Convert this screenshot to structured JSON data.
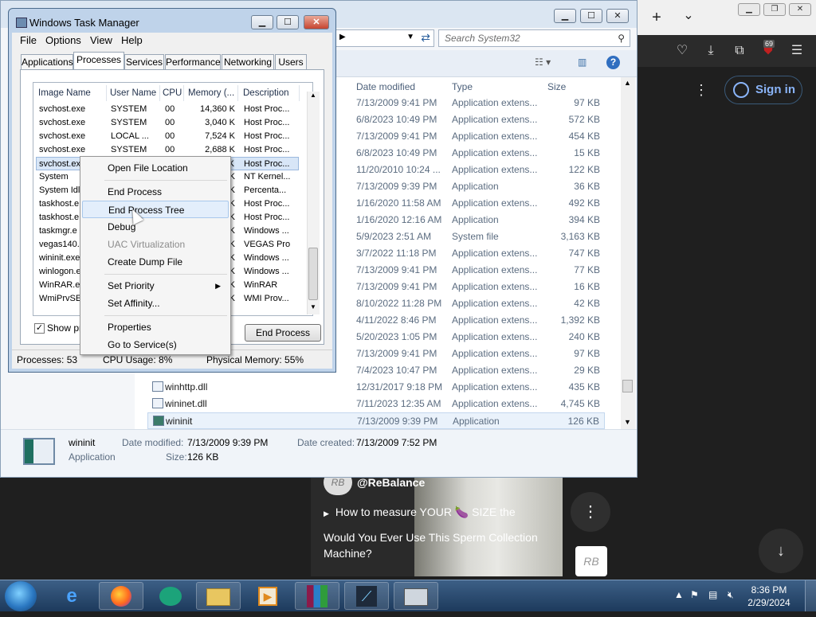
{
  "browser": {
    "new_tab": "+",
    "tab_dropdown": "⌄",
    "extension_badge": "69",
    "sign_in": "Sign in",
    "video": {
      "channel": "@ReBalance",
      "playlist_line": "How to measure YOUR 🍆 SIZE the",
      "title_line1": "Would You Ever Use This Sperm Collection",
      "title_line2": "Machine?",
      "logo_text": "RB"
    }
  },
  "explorer": {
    "search_placeholder": "Search System32",
    "columns": [
      "Date modified",
      "Type",
      "Size"
    ],
    "rows": [
      {
        "date": "7/13/2009 9:41 PM",
        "type": "Application extens...",
        "size": "97 KB"
      },
      {
        "date": "6/8/2023 10:49 PM",
        "type": "Application extens...",
        "size": "572 KB"
      },
      {
        "date": "7/13/2009 9:41 PM",
        "type": "Application extens...",
        "size": "454 KB"
      },
      {
        "date": "6/8/2023 10:49 PM",
        "type": "Application extens...",
        "size": "15 KB"
      },
      {
        "date": "11/20/2010 10:24 ...",
        "type": "Application extens...",
        "size": "122 KB"
      },
      {
        "date": "7/13/2009 9:39 PM",
        "type": "Application",
        "size": "36 KB"
      },
      {
        "date": "1/16/2020 11:58 AM",
        "type": "Application extens...",
        "size": "492 KB"
      },
      {
        "date": "1/16/2020 12:16 AM",
        "type": "Application",
        "size": "394 KB"
      },
      {
        "date": "5/9/2023 2:51 AM",
        "type": "System file",
        "size": "3,163 KB"
      },
      {
        "date": "3/7/2022 11:18 PM",
        "type": "Application extens...",
        "size": "747 KB"
      },
      {
        "date": "7/13/2009 9:41 PM",
        "type": "Application extens...",
        "size": "77 KB"
      },
      {
        "date": "7/13/2009 9:41 PM",
        "type": "Application extens...",
        "size": "16 KB"
      },
      {
        "date": "8/10/2022 11:28 PM",
        "type": "Application extens...",
        "size": "42 KB"
      },
      {
        "date": "4/11/2022 8:46 PM",
        "type": "Application extens...",
        "size": "1,392 KB"
      },
      {
        "date": "5/20/2023 1:05 PM",
        "type": "Application extens...",
        "size": "240 KB"
      },
      {
        "date": "7/13/2009 9:41 PM",
        "type": "Application extens...",
        "size": "97 KB"
      },
      {
        "date": "7/4/2023 10:47 PM",
        "type": "Application extens...",
        "size": "29 KB"
      }
    ],
    "named_rows": [
      {
        "name": "winhttp.dll",
        "date": "12/31/2017 9:18 PM",
        "type": "Application extens...",
        "size": "435 KB"
      },
      {
        "name": "wininet.dll",
        "date": "7/11/2023 12:35 AM",
        "type": "Application extens...",
        "size": "4,745 KB"
      },
      {
        "name": "wininit",
        "date": "7/13/2009 9:39 PM",
        "type": "Application",
        "size": "126 KB"
      }
    ],
    "details": {
      "name": "wininit",
      "kind": "Application",
      "modified_label": "Date modified:",
      "modified": "7/13/2009 9:39 PM",
      "created_label": "Date created:",
      "created": "7/13/2009 7:52 PM",
      "size_label": "Size:",
      "size": "126 KB"
    }
  },
  "taskmgr": {
    "title": "Windows Task Manager",
    "menu": [
      "File",
      "Options",
      "View",
      "Help"
    ],
    "tabs": [
      "Applications",
      "Processes",
      "Services",
      "Performance",
      "Networking",
      "Users"
    ],
    "columns": [
      "Image Name",
      "User Name",
      "CPU",
      "Memory (...",
      "Description"
    ],
    "processes": [
      {
        "name": "svchost.exe",
        "user": "SYSTEM",
        "cpu": "00",
        "mem": "14,360 K",
        "desc": "Host Proc..."
      },
      {
        "name": "svchost.exe",
        "user": "SYSTEM",
        "cpu": "00",
        "mem": "3,040 K",
        "desc": "Host Proc..."
      },
      {
        "name": "svchost.exe",
        "user": "LOCAL ...",
        "cpu": "00",
        "mem": "7,524 K",
        "desc": "Host Proc..."
      },
      {
        "name": "svchost.exe",
        "user": "SYSTEM",
        "cpu": "00",
        "mem": "2,688 K",
        "desc": "Host Proc..."
      },
      {
        "name": "svchost.exe",
        "user": "",
        "cpu": "",
        "mem": "K",
        "desc": "Host Proc..."
      },
      {
        "name": "System",
        "user": "",
        "cpu": "",
        "mem": "K",
        "desc": "NT Kernel..."
      },
      {
        "name": "System Idl",
        "user": "",
        "cpu": "",
        "mem": "K",
        "desc": "Percenta..."
      },
      {
        "name": "taskhost.e",
        "user": "",
        "cpu": "",
        "mem": "K",
        "desc": "Host Proc..."
      },
      {
        "name": "taskhost.e",
        "user": "",
        "cpu": "",
        "mem": "K",
        "desc": "Host Proc..."
      },
      {
        "name": "taskmgr.e",
        "user": "",
        "cpu": "",
        "mem": "K",
        "desc": "Windows ..."
      },
      {
        "name": "vegas140.",
        "user": "",
        "cpu": "",
        "mem": "K",
        "desc": "VEGAS Pro"
      },
      {
        "name": "wininit.exe",
        "user": "",
        "cpu": "",
        "mem": "K",
        "desc": "Windows ..."
      },
      {
        "name": "winlogon.e",
        "user": "",
        "cpu": "",
        "mem": "K",
        "desc": "Windows ..."
      },
      {
        "name": "WinRAR.ex",
        "user": "",
        "cpu": "",
        "mem": "K",
        "desc": "WinRAR"
      },
      {
        "name": "WmiPrvSE.",
        "user": "",
        "cpu": "",
        "mem": "K",
        "desc": "WMI Prov..."
      }
    ],
    "show_all": "Show pro",
    "end_process": "End Process",
    "status": {
      "processes": "Processes: 53",
      "cpu": "CPU Usage: 8%",
      "memory": "Physical Memory: 55%"
    }
  },
  "context_menu": {
    "items": [
      "Open File Location",
      "End Process",
      "End Process Tree",
      "Debug",
      "UAC Virtualization",
      "Create Dump File",
      "Set Priority",
      "Set Affinity...",
      "Properties",
      "Go to Service(s)"
    ]
  },
  "taskbar": {
    "time": "8:36 PM",
    "date": "2/29/2024"
  },
  "colors": {
    "selection": "#d8e6f7",
    "highlight": "#e3eefb",
    "accent": "#8ab4f8"
  }
}
